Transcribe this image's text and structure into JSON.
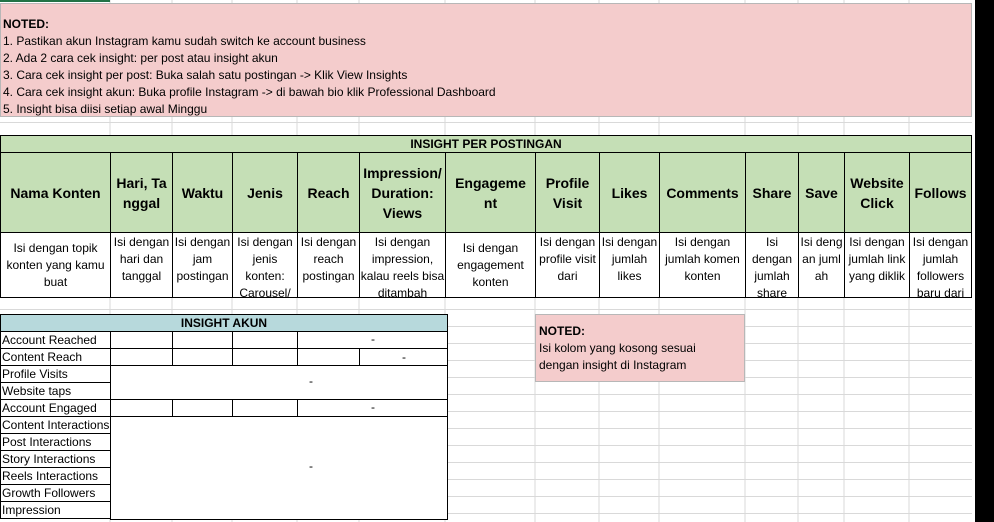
{
  "notes_top": {
    "title": "NOTED:",
    "lines": [
      "1. Pastikan akun Instagram kamu sudah switch ke account business",
      "2. Ada 2 cara cek insight: per post atau insight akun",
      "3. Cara cek insight per post: Buka salah satu postingan -> Klik View Insights",
      "4. Cara cek insight akun: Buka profile Instagram -> di bawah bio klik Professional Dashboard",
      "5. Insight bisa diisi setiap awal Minggu"
    ]
  },
  "insight_per_postingan": {
    "title": "INSIGHT PER POSTINGAN",
    "headers": [
      "Nama Konten",
      "Hari, Tanggal",
      "Waktu",
      "Jenis",
      "Reach",
      "Impression/ Duration: Views",
      "Engagement",
      "Profile Visit",
      "Likes",
      "Comments",
      "Share",
      "Save",
      "Website Click",
      "Follows"
    ],
    "descriptions": [
      "Isi dengan topik konten yang kamu buat",
      "Isi dengan hari dan tanggal",
      "Isi dengan jam postingan",
      "Isi dengan jenis konten: Carousel/",
      "Isi dengan reach postingan",
      "Isi dengan impression, kalau reels bisa ditambah",
      "Isi dengan engagement konten",
      "Isi dengan profile visit dari",
      "Isi dengan jumlah likes",
      "Isi dengan jumlah komen konten",
      "Isi dengan jumlah share",
      "Isi dengan jumlah",
      "Isi dengan jumlah link yang diklik",
      "Isi dengan jumlah followers baru dari"
    ]
  },
  "insight_akun": {
    "title": "INSIGHT AKUN",
    "rows": [
      "Account Reached",
      "Content Reach",
      "Profile Visits",
      "Website taps",
      "Account Engaged",
      "Content Interactions",
      "Post Interactions",
      "Story Interactions",
      "Reels Interactions",
      "Growth Followers",
      "Impression"
    ],
    "placeholder": "-"
  },
  "notes_right": {
    "title": "NOTED:",
    "lines": [
      "Isi kolom yang kosong sesuai",
      "dengan insight di Instagram"
    ]
  },
  "colors": {
    "note_bg": "#f4cccc",
    "header_green": "#c5dfb6",
    "header_blue": "#b7d9dc",
    "grid_line": "#d9d9d9"
  }
}
